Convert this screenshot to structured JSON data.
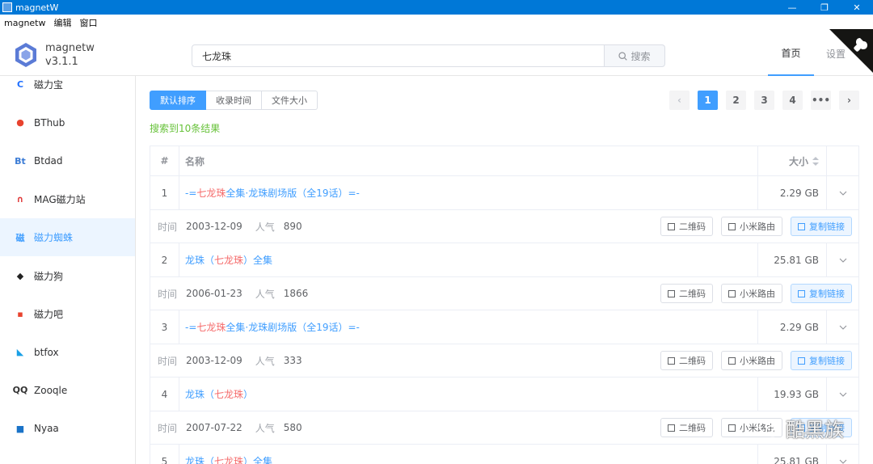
{
  "window": {
    "title": "magnetW",
    "controls": [
      "—",
      "❐",
      "✕"
    ]
  },
  "menu": [
    "magnetw",
    "编辑",
    "窗口"
  ],
  "brand": {
    "name": "magnetw",
    "version": "v3.1.1"
  },
  "search": {
    "value": "七龙珠",
    "button": "搜索"
  },
  "nav": {
    "home": "首页",
    "settings": "设置"
  },
  "sidebar": [
    {
      "label": "磁力宝",
      "icon": "c-icon",
      "glyph": "C",
      "color": "#1e6fff"
    },
    {
      "label": "BThub",
      "icon": "bthub-icon",
      "glyph": "●",
      "color": "#e8432e"
    },
    {
      "label": "Btdad",
      "icon": "btdad-icon",
      "glyph": "Bt",
      "color": "#3a7bd5"
    },
    {
      "label": "MAG磁力站",
      "icon": "magnet-icon",
      "glyph": "∩",
      "color": "#e03b3b"
    },
    {
      "label": "磁力蜘蛛",
      "icon": "spider-icon",
      "glyph": "磁",
      "color": "#409eff"
    },
    {
      "label": "磁力狗",
      "icon": "dog-icon",
      "glyph": "◆",
      "color": "#222222"
    },
    {
      "label": "磁力吧",
      "icon": "cilibar-icon",
      "glyph": "▪",
      "color": "#e8432e"
    },
    {
      "label": "btfox",
      "icon": "fox-icon",
      "glyph": "◣",
      "color": "#1aa0e6"
    },
    {
      "label": "Zooqle",
      "icon": "zooqle-icon",
      "glyph": "QQ",
      "color": "#333333"
    },
    {
      "label": "Nyaa",
      "icon": "nyaa-icon",
      "glyph": "■",
      "color": "#1a73c8"
    }
  ],
  "active_sidebar": 4,
  "sort": {
    "options": [
      "默认排序",
      "收录时间",
      "文件大小"
    ],
    "active": 0
  },
  "pager": {
    "pages": [
      "1",
      "2",
      "3",
      "4"
    ],
    "active": 0,
    "prev": "‹",
    "next": "›",
    "more": "•••"
  },
  "result_count": "搜索到10条结果",
  "table": {
    "headers": {
      "index": "#",
      "name": "名称",
      "size": "大小"
    },
    "labels": {
      "time": "时间",
      "popularity": "人气"
    },
    "actions": {
      "qr": "二维码",
      "router": "小米路由",
      "copy": "复制链接"
    },
    "rows": [
      {
        "index": "1",
        "pre": "-= ",
        "hl": "七龙珠",
        "post": "全集·龙珠剧场版（全19话）=-",
        "size": "2.29 GB",
        "time": "2003-12-09",
        "popularity": "890"
      },
      {
        "index": "2",
        "pre": "龙珠（",
        "hl": "七龙珠",
        "post": "）全集",
        "size": "25.81 GB",
        "time": "2006-01-23",
        "popularity": "1866"
      },
      {
        "index": "3",
        "pre": "-= ",
        "hl": "七龙珠",
        "post": "全集·龙珠剧场版（全19话）=-",
        "size": "2.29 GB",
        "time": "2003-12-09",
        "popularity": "333"
      },
      {
        "index": "4",
        "pre": "龙珠（",
        "hl": "七龙珠",
        "post": "）",
        "size": "19.93 GB",
        "time": "2007-07-22",
        "popularity": "580"
      },
      {
        "index": "5",
        "pre": "龙珠（",
        "hl": "七龙珠",
        "post": "）全集",
        "size": "25.81 GB",
        "time": "",
        "popularity": ""
      }
    ]
  },
  "watermark": "酷黑族"
}
